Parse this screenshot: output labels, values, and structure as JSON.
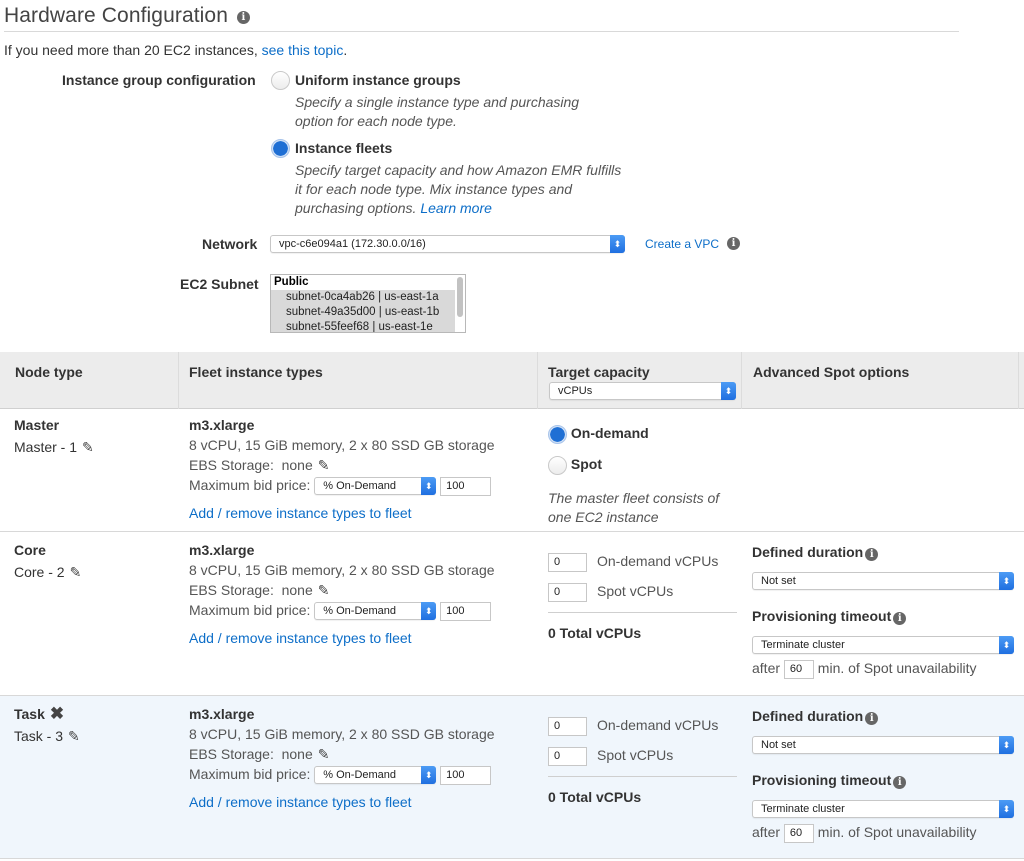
{
  "page": {
    "title": "Hardware Configuration",
    "note_prefix": "If you need more than 20 EC2 instances, ",
    "note_link": "see this topic",
    "note_suffix": "."
  },
  "instance_group_config": {
    "label": "Instance group configuration",
    "options": [
      {
        "title": "Uniform instance groups",
        "desc": "Specify a single instance type and purchasing option for each node type.",
        "selected": false
      },
      {
        "title": "Instance fleets",
        "desc": "Specify target capacity and how Amazon EMR fulfills it for each node type. Mix instance types and purchasing options.",
        "link": "Learn more",
        "selected": true
      }
    ]
  },
  "network": {
    "label": "Network",
    "value": "vpc-c6e094a1 (172.30.0.0/16)",
    "create_link": "Create a VPC"
  },
  "subnet": {
    "label": "EC2 Subnet",
    "group": "Public",
    "items": [
      "subnet-0ca4ab26 | us-east-1a",
      "subnet-49a35d00 | us-east-1b",
      "subnet-55feef68 | us-east-1e"
    ]
  },
  "table": {
    "headers": {
      "node_type": "Node type",
      "fleet": "Fleet instance types",
      "target": "Target capacity",
      "advanced": "Advanced Spot options"
    },
    "target_unit": "vCPUs",
    "rows": [
      {
        "node": "Master",
        "name": "Master - 1",
        "instance_type": "m3.xlarge",
        "specs": "8 vCPU, 15 GiB memory, 2 x 80 SSD GB storage",
        "ebs_label": "EBS Storage:",
        "ebs_value": "none",
        "bid_label": "Maximum bid price:",
        "bid_type": "% On-Demand",
        "bid_value": "100",
        "add_link": "Add / remove instance types to fleet",
        "on_demand_label": "On-demand",
        "spot_label": "Spot",
        "master_note": "The master fleet consists of one EC2 instance"
      },
      {
        "node": "Core",
        "name": "Core - 2",
        "instance_type": "m3.xlarge",
        "specs": "8 vCPU, 15 GiB memory, 2 x 80 SSD GB storage",
        "ebs_label": "EBS Storage:",
        "ebs_value": "none",
        "bid_label": "Maximum bid price:",
        "bid_type": "% On-Demand",
        "bid_value": "100",
        "add_link": "Add / remove instance types to fleet",
        "on_demand_value": "0",
        "on_demand_label": "On-demand vCPUs",
        "spot_value": "0",
        "spot_label": "Spot vCPUs",
        "total": "0 Total vCPUs",
        "defined_duration_label": "Defined duration",
        "defined_duration_value": "Not set",
        "prov_timeout_label": "Provisioning timeout",
        "prov_timeout_value": "Terminate cluster",
        "after_label": "after",
        "after_value": "60",
        "after_suffix": "min. of Spot unavailability"
      },
      {
        "node": "Task",
        "name": "Task - 3",
        "instance_type": "m3.xlarge",
        "specs": "8 vCPU, 15 GiB memory, 2 x 80 SSD GB storage",
        "ebs_label": "EBS Storage:",
        "ebs_value": "none",
        "bid_label": "Maximum bid price:",
        "bid_type": "% On-Demand",
        "bid_value": "100",
        "add_link": "Add / remove instance types to fleet",
        "on_demand_value": "0",
        "on_demand_label": "On-demand vCPUs",
        "spot_value": "0",
        "spot_label": "Spot vCPUs",
        "total": "0 Total vCPUs",
        "defined_duration_label": "Defined duration",
        "defined_duration_value": "Not set",
        "prov_timeout_label": "Provisioning timeout",
        "prov_timeout_value": "Terminate cluster",
        "after_label": "after",
        "after_value": "60",
        "after_suffix": "min. of Spot unavailability"
      }
    ]
  },
  "icons": {
    "info": "i",
    "pencil": "✎",
    "remove": "✖",
    "select_arrow": "⬍"
  }
}
